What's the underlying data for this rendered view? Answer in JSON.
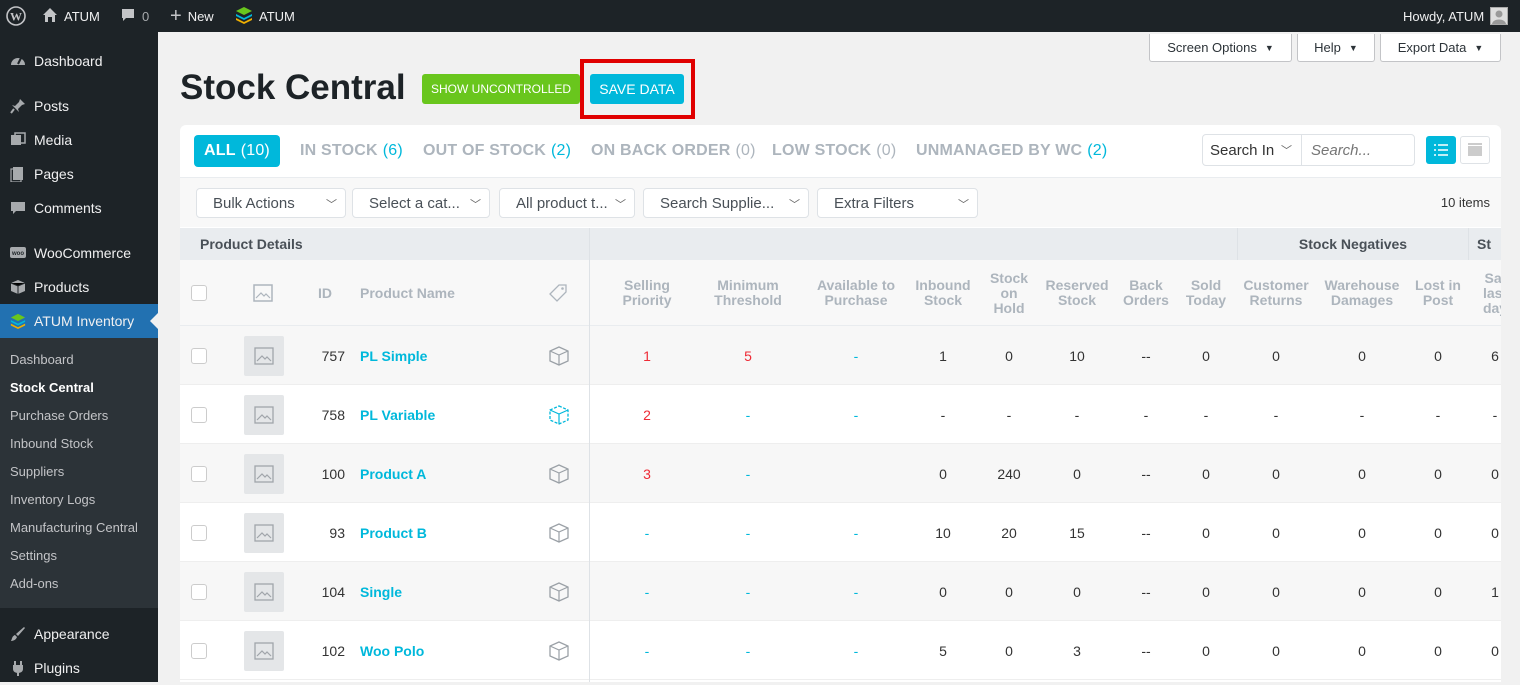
{
  "adminbar": {
    "site": "ATUM",
    "comments": "0",
    "new": "New",
    "plugin": "ATUM",
    "howdy": "Howdy, ATUM"
  },
  "sidebar": {
    "items": [
      "Dashboard",
      "Posts",
      "Media",
      "Pages",
      "Comments",
      "WooCommerce",
      "Products",
      "ATUM Inventory",
      "Appearance",
      "Plugins"
    ],
    "sub": [
      "Dashboard",
      "Stock Central",
      "Purchase Orders",
      "Inbound Stock",
      "Suppliers",
      "Inventory Logs",
      "Manufacturing Central",
      "Settings",
      "Add-ons"
    ]
  },
  "topbuttons": {
    "screen": "Screen Options",
    "help": "Help",
    "export": "Export Data"
  },
  "page": {
    "title": "Stock Central",
    "uncontrolled": "SHOW UNCONTROLLED",
    "save": "SAVE DATA"
  },
  "views": [
    {
      "label": "ALL",
      "count": "(10)"
    },
    {
      "label": "IN STOCK",
      "count": "(6)"
    },
    {
      "label": "OUT OF STOCK",
      "count": "(2)"
    },
    {
      "label": "ON BACK ORDER",
      "count": "(0)"
    },
    {
      "label": "LOW STOCK",
      "count": "(0)"
    },
    {
      "label": "UNMANAGED BY WC",
      "count": "(2)"
    }
  ],
  "search": {
    "in": "Search In",
    "placeholder": "Search..."
  },
  "filters": {
    "bulk": "Bulk Actions",
    "cat": "Select a cat...",
    "type": "All product t...",
    "supplier": "Search Supplie...",
    "extra": "Extra Filters",
    "items": "10 items"
  },
  "groups": {
    "details": "Product Details",
    "negatives": "Stock Negatives",
    "next": "St"
  },
  "headers": {
    "id": "ID",
    "name": "Product Name",
    "cols": [
      "Selling Priority",
      "Minimum Threshold",
      "Available to Purchase",
      "Inbound Stock",
      "Stock on Hold",
      "Reserved Stock",
      "Back Orders",
      "Sold Today",
      "Customer Returns",
      "Warehouse Damages",
      "Lost in Post",
      "Sal last day"
    ]
  },
  "rows": [
    {
      "id": "757",
      "name": "PL Simple",
      "vals": [
        "1",
        "5",
        "-",
        "1",
        "0",
        "10",
        "--",
        "0",
        "0",
        "0",
        "0",
        "6"
      ]
    },
    {
      "id": "758",
      "name": "PL Variable",
      "vals": [
        "2",
        "-",
        "-",
        "-",
        "-",
        "-",
        "-",
        "-",
        "-",
        "-",
        "-",
        "-"
      ]
    },
    {
      "id": "100",
      "name": "Product A",
      "vals": [
        "3",
        "-",
        "",
        "0",
        "240",
        "0",
        "--",
        "0",
        "0",
        "0",
        "0",
        "0"
      ]
    },
    {
      "id": "93",
      "name": "Product B",
      "vals": [
        "-",
        "-",
        "-",
        "10",
        "20",
        "15",
        "--",
        "0",
        "0",
        "0",
        "0",
        "0"
      ]
    },
    {
      "id": "104",
      "name": "Single",
      "vals": [
        "-",
        "-",
        "-",
        "0",
        "0",
        "0",
        "--",
        "0",
        "0",
        "0",
        "0",
        "1"
      ]
    },
    {
      "id": "102",
      "name": "Woo Polo",
      "vals": [
        "-",
        "-",
        "-",
        "5",
        "0",
        "3",
        "--",
        "0",
        "0",
        "0",
        "0",
        "0"
      ]
    }
  ]
}
